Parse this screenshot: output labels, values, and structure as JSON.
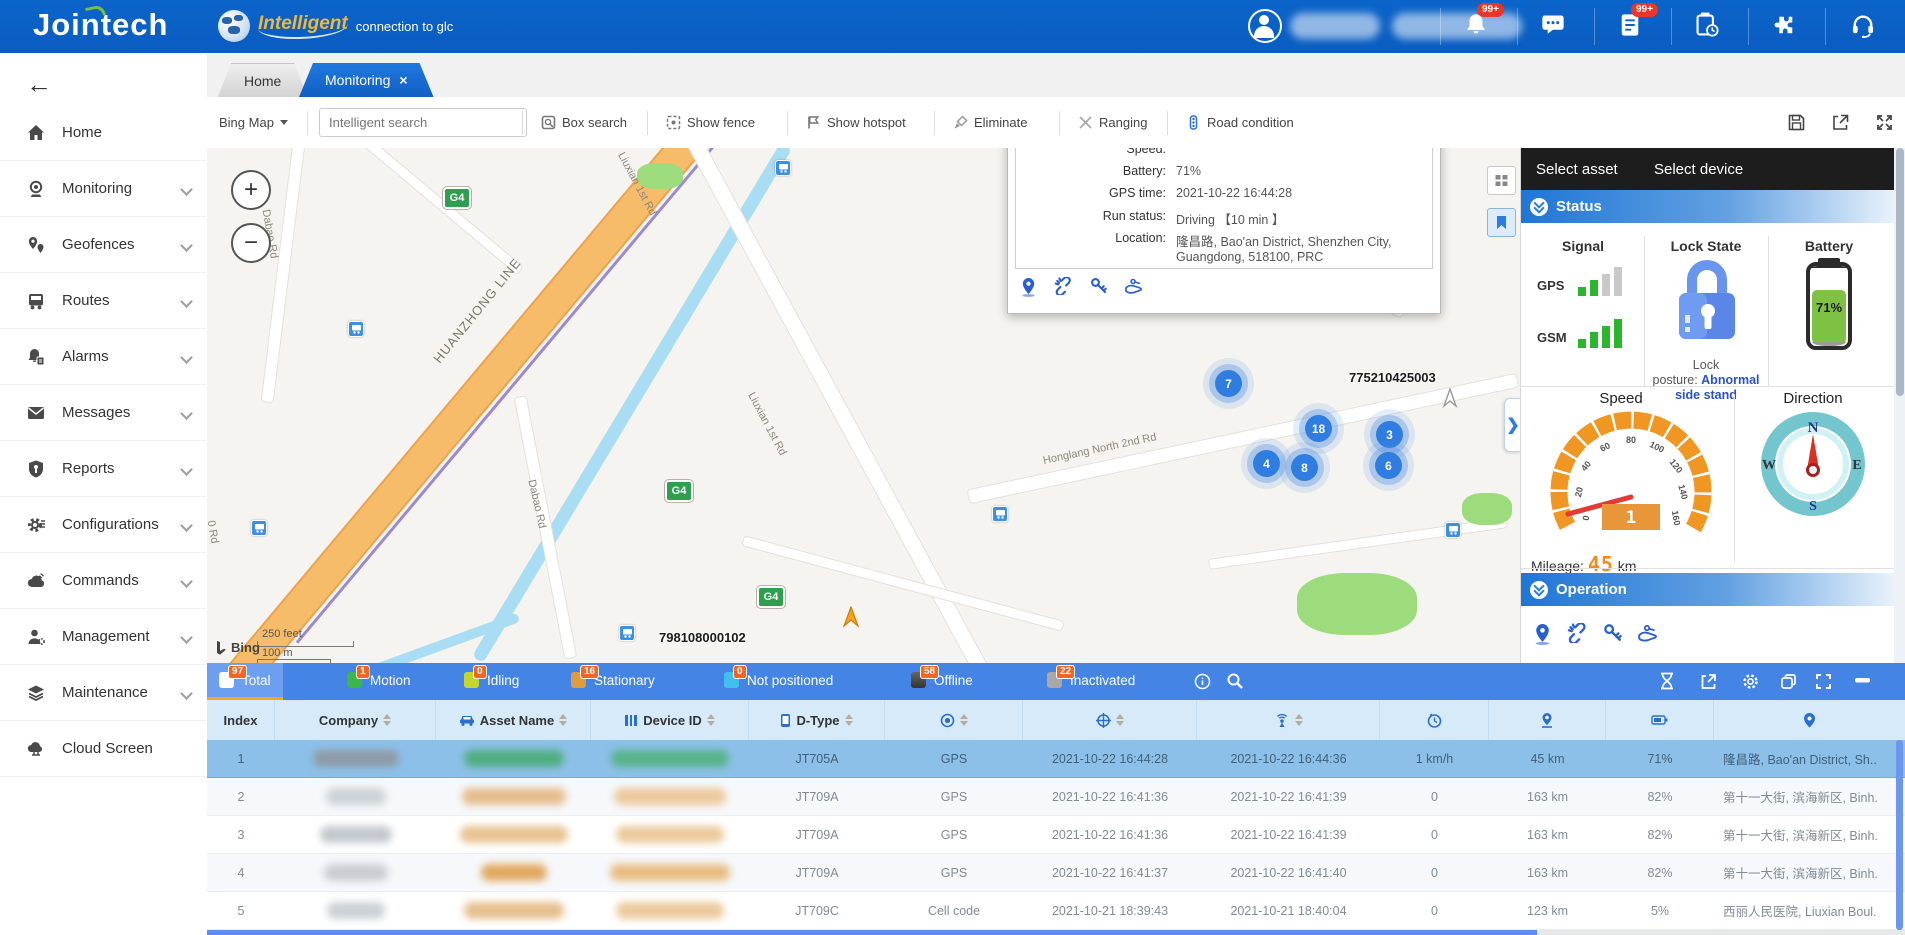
{
  "header": {
    "logo": "Jointech",
    "tagline_highlight": "Intelligent",
    "tagline_rest": "connection to glc",
    "notification_badge": "99+",
    "task_badge": "99+"
  },
  "back_arrow": "←",
  "tabs": {
    "home": "Home",
    "monitoring": "Monitoring",
    "close": "×"
  },
  "toolbar": {
    "map_provider": "Bing Map",
    "search_placeholder": "Intelligent search",
    "box_search": "Box search",
    "show_fence": "Show fence",
    "show_hotspot": "Show hotspot",
    "eliminate": "Eliminate",
    "ranging": "Ranging",
    "road_condition": "Road condition"
  },
  "sidebar": {
    "items": [
      {
        "label": "Home"
      },
      {
        "label": "Monitoring"
      },
      {
        "label": "Geofences"
      },
      {
        "label": "Routes"
      },
      {
        "label": "Alarms"
      },
      {
        "label": "Messages"
      },
      {
        "label": "Reports"
      },
      {
        "label": "Configurations"
      },
      {
        "label": "Commands"
      },
      {
        "label": "Management"
      },
      {
        "label": "Maintenance"
      },
      {
        "label": "Cloud Screen"
      }
    ]
  },
  "map": {
    "zoom_in": "+",
    "zoom_out": "−",
    "roads": {
      "huanzhong": "HUANZHONG LINE",
      "liuxian": "Liuxian 1st Rd",
      "dabao": "Dabao Rd",
      "honglang": "Honglang North 2nd Rd",
      "o_rd": "0 Rd"
    },
    "shield": "G4",
    "clusters": [
      "7",
      "18",
      "4",
      "8",
      "3",
      "6"
    ],
    "device_labels": {
      "right": "775210425003",
      "bottom": "798108000102"
    },
    "scale_feet": "250 feet",
    "scale_m": "100 m",
    "attribution": "Bing"
  },
  "popup": {
    "clipped_label": "Speed:",
    "rows": [
      {
        "label": "Battery:",
        "value": "71%"
      },
      {
        "label": "GPS time:",
        "value": "2021-10-22 16:44:28"
      },
      {
        "label": "Run status:",
        "value": "Driving 【10 min 】"
      },
      {
        "label": "Location:",
        "value": "隆昌路, Bao'an District, Shenzhen City, Guangdong, 518100, PRC"
      }
    ]
  },
  "panel": {
    "tabs": {
      "asset": "Select asset",
      "device": "Select device"
    },
    "status": {
      "title": "Status",
      "signal": {
        "label": "Signal",
        "gps": "GPS",
        "gsm": "GSM",
        "gps_bars": 2,
        "gsm_bars": 4
      },
      "lock": {
        "label": "Lock State",
        "line1": "Lock",
        "line2_prefix": "posture:",
        "line2_value": "Abnormal",
        "line3_value": "side stand"
      },
      "battery": {
        "label": "Battery",
        "value": "71%"
      },
      "speed": {
        "label": "Speed",
        "ticks": [
          "0",
          "20",
          "40",
          "60",
          "80",
          "100",
          "120",
          "140",
          "160"
        ],
        "digital": "1"
      },
      "direction": {
        "label": "Direction",
        "n": "N",
        "e": "E",
        "s": "S",
        "w": "W"
      },
      "mileage": {
        "label": "Mileage:",
        "value": "45",
        "unit": "km"
      }
    },
    "operation": {
      "title": "Operation"
    }
  },
  "filterbar": {
    "tabs": [
      {
        "label": "Total",
        "count": "97",
        "color": "#ffffff",
        "active": true
      },
      {
        "label": "Motion",
        "count": "1",
        "color": "#3cb54a"
      },
      {
        "label": "Idling",
        "count": "0",
        "color": "#c3d52f"
      },
      {
        "label": "Stationary",
        "count": "16",
        "color": "#e09b3d"
      },
      {
        "label": "Not positioned",
        "count": "0",
        "color": "#41c0f0"
      },
      {
        "label": "Offline",
        "count": "58",
        "color": "#4a4a4a"
      },
      {
        "label": "Inactivated",
        "count": "22",
        "color": "#a8a8a8"
      }
    ]
  },
  "table": {
    "columns": [
      {
        "label": "Index"
      },
      {
        "label": "Company"
      },
      {
        "label": "Asset Name"
      },
      {
        "label": "Device ID"
      },
      {
        "label": "D-Type"
      },
      {
        "label": ""
      },
      {
        "label": ""
      },
      {
        "label": ""
      },
      {
        "label": ""
      },
      {
        "label": ""
      },
      {
        "label": ""
      },
      {
        "label": ""
      }
    ],
    "rows": [
      {
        "index": "1",
        "dtype": "JT705A",
        "position_type": "GPS",
        "gps_time": "2021-10-22 16:44:28",
        "receive_time": "2021-10-22 16:44:36",
        "speed": "1 km/h",
        "mileage": "45 km",
        "battery": "71%",
        "location": "隆昌路, Bao'an District, Sh.."
      },
      {
        "index": "2",
        "dtype": "JT709A",
        "position_type": "GPS",
        "gps_time": "2021-10-22 16:41:36",
        "receive_time": "2021-10-22 16:41:39",
        "speed": "0",
        "mileage": "163 km",
        "battery": "82%",
        "location": "第十一大街, 滨海新区, Binh."
      },
      {
        "index": "3",
        "dtype": "JT709A",
        "position_type": "GPS",
        "gps_time": "2021-10-22 16:41:36",
        "receive_time": "2021-10-22 16:41:39",
        "speed": "0",
        "mileage": "163 km",
        "battery": "82%",
        "location": "第十一大街, 滨海新区, Binh."
      },
      {
        "index": "4",
        "dtype": "JT709A",
        "position_type": "GPS",
        "gps_time": "2021-10-22 16:41:37",
        "receive_time": "2021-10-22 16:41:40",
        "speed": "0",
        "mileage": "163 km",
        "battery": "82%",
        "location": "第十一大街, 滨海新区, Binh."
      },
      {
        "index": "5",
        "dtype": "JT709C",
        "position_type": "Cell code",
        "gps_time": "2021-10-21 18:39:43",
        "receive_time": "2021-10-21 18:40:04",
        "speed": "0",
        "mileage": "123 km",
        "battery": "5%",
        "location": "西丽人民医院, Liuxian Boul."
      }
    ]
  }
}
